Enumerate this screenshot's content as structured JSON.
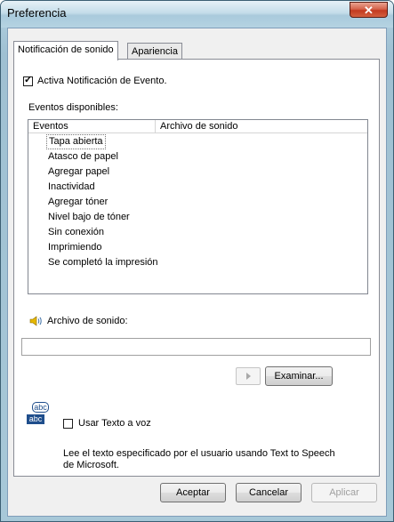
{
  "window": {
    "title": "Preferencia",
    "close_glyph": "✕"
  },
  "tabs": [
    {
      "label": "Notificación de sonido",
      "active": true
    },
    {
      "label": "Apariencia",
      "active": false
    }
  ],
  "notification": {
    "checkbox_label": "Activa Notificación de Evento.",
    "checked": true
  },
  "events": {
    "section_label": "Eventos disponibles:",
    "columns": [
      "Eventos",
      "Archivo de sonido"
    ],
    "items": [
      "Tapa abierta",
      "Atasco de papel",
      "Agregar papel",
      "Inactividad",
      "Agregar tóner",
      "Nivel bajo de tóner",
      "Sin conexión",
      "Imprimiendo",
      "Se completó la impresión"
    ]
  },
  "sound": {
    "label": "Archivo de sonido:",
    "value": "",
    "browse_label": "Examinar..."
  },
  "tts": {
    "checkbox_label": "Usar Texto a voz",
    "checked": false,
    "icon_text_top": "abc",
    "icon_text_bottom": "abc",
    "description_line1": "Lee el texto especificado por el usuario usando Text to Speech",
    "description_line2": "de Microsoft."
  },
  "footer": {
    "accept_label": "Aceptar",
    "cancel_label": "Cancelar",
    "apply_label": "Aplicar"
  }
}
